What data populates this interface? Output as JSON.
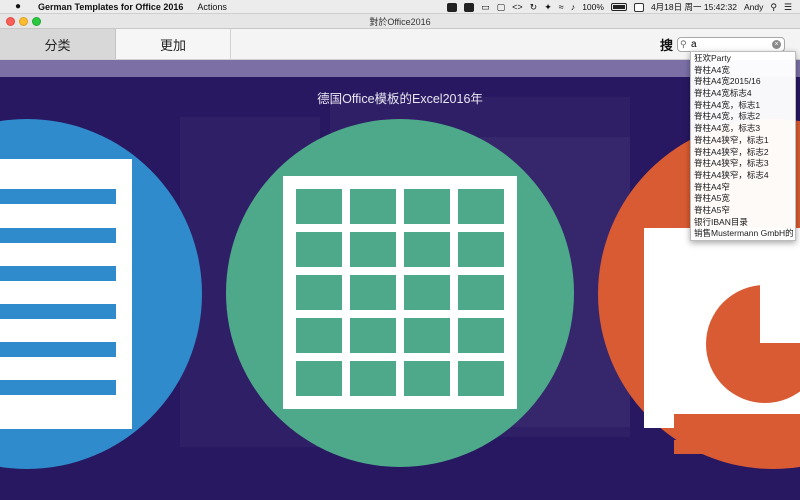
{
  "menubar": {
    "app_name": "German Templates for Office 2016",
    "menus": [
      "Actions"
    ],
    "battery": "100%",
    "date_time": "4月18日 周一  15:42:32",
    "user": "Andy"
  },
  "window": {
    "title": "對於Office2016"
  },
  "toolbar": {
    "tabs": [
      {
        "label": "分类"
      },
      {
        "label": "更加"
      }
    ],
    "search_label": "搜",
    "search_value": "a"
  },
  "content": {
    "heading": "德国Office模板的Excel2016年"
  },
  "colors": {
    "background": "#281761",
    "word_blue": "#2f8bcb",
    "excel_green": "#4ea98a",
    "powerpoint_orange": "#d95b33"
  },
  "dropdown": {
    "items": [
      "狂欢Party",
      "脊柱A4宽",
      "脊柱A4宽2015/16",
      "脊柱A4宽标志4",
      "脊柱A4宽，标志1",
      "脊柱A4宽，标志2",
      "脊柱A4宽，标志3",
      "脊柱A4狭窄，标志1",
      "脊柱A4狭窄，标志2",
      "脊柱A4狭窄，标志3",
      "脊柱A4狭窄，标志4",
      "脊柱A4窄",
      "脊柱A5宽",
      "脊柱A5窄",
      "银行IBAN目录",
      "销售Mustermann GmbH的"
    ]
  }
}
